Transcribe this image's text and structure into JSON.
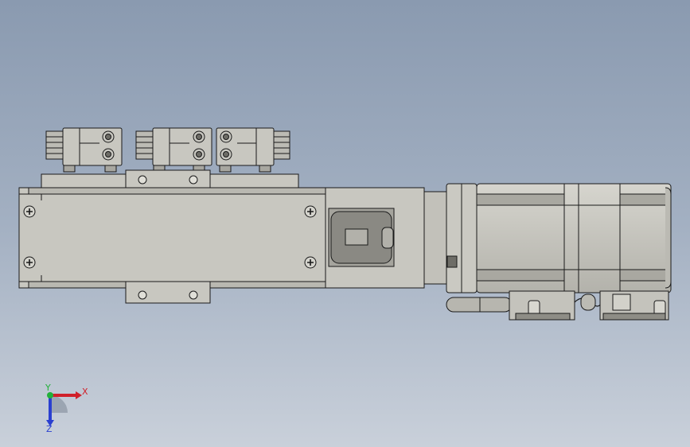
{
  "viewport": {
    "background_top": "#8a9ab0",
    "background_bottom": "#c9d0da"
  },
  "model": {
    "body_color": "#c8c7c0",
    "edge_color": "#1a1a1a",
    "shade_color": "#9c9b94",
    "icon": "linear-actuator-with-servo-motor"
  },
  "triad": {
    "x_label": "X",
    "y_label": "Y",
    "z_label": "Z",
    "x_color": "#d0202a",
    "y_color": "#22b03a",
    "z_color": "#2a3fd0"
  }
}
